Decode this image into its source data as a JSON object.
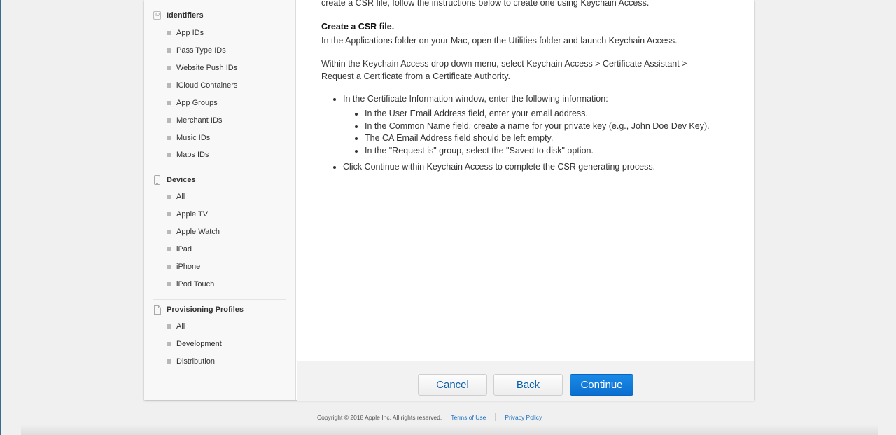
{
  "sidebar": {
    "identifiers": {
      "title": "Identifiers",
      "icon": "id-icon",
      "icon_text": "ID",
      "items": [
        "App IDs",
        "Pass Type IDs",
        "Website Push IDs",
        "iCloud Containers",
        "App Groups",
        "Merchant IDs",
        "Music IDs",
        "Maps IDs"
      ]
    },
    "devices": {
      "title": "Devices",
      "icon": "device-icon",
      "items": [
        "All",
        "Apple TV",
        "Apple Watch",
        "iPad",
        "iPhone",
        "iPod Touch"
      ]
    },
    "profiles": {
      "title": "Provisioning Profiles",
      "icon": "document-icon",
      "items": [
        "All",
        "Development",
        "Distribution"
      ]
    }
  },
  "content": {
    "intro_cut": "create a CSR file, follow the instructions below to create one using Keychain Access.",
    "heading": "Create a CSR file.",
    "para1": "In the Applications folder on your Mac, open the Utilities folder and launch Keychain Access.",
    "para2_line1": "Within the Keychain Access drop down menu, select Keychain Access > Certificate Assistant >",
    "para2_line2": "Request a Certificate from a Certificate Authority.",
    "bullets": {
      "first": "In the Certificate Information window, enter the following information:",
      "sub": [
        "In the User Email Address field, enter your email address.",
        "In the Common Name field, create a name for your private key (e.g., John Doe Dev Key).",
        "The CA Email Address field should be left empty.",
        "In the \"Request is\" group, select the \"Saved to disk\" option."
      ],
      "second": "Click Continue within Keychain Access to complete the CSR generating process."
    }
  },
  "buttons": {
    "cancel": "Cancel",
    "back": "Back",
    "continue": "Continue"
  },
  "footer": {
    "copyright": "Copyright © 2018 Apple Inc. All rights reserved.",
    "terms": "Terms of Use",
    "privacy": "Privacy Policy"
  },
  "colors": {
    "accent": "#0b6fd0",
    "link": "#1a6fbf"
  }
}
